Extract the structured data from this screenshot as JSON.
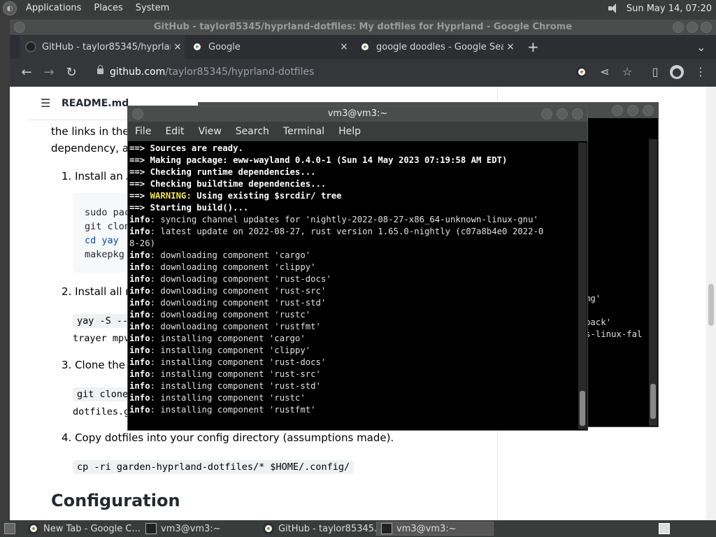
{
  "topbar": {
    "menu": [
      "Applications",
      "Places",
      "System"
    ],
    "clock": "Sun May 14, 07:20"
  },
  "chrome": {
    "window_title": "GitHub - taylor85345/hyprland-dotfiles: My dotfiles for Hyprland - Google Chrome",
    "tabs": [
      {
        "title": "GitHub - taylor85345/hyprland",
        "close": "×"
      },
      {
        "title": "Google",
        "close": "×"
      },
      {
        "title": "google doodles - Google Sear",
        "close": "×"
      }
    ],
    "new_tab": "+",
    "tab_menu": "⌄",
    "url_domain": "github.com",
    "url_path": "/taylor85345/hyprland-dotfiles",
    "icons": {
      "back": "←",
      "forward": "→",
      "reload": "↻",
      "share": "⋖",
      "star": "☆",
      "sidebar": "▯",
      "menu": "⋮"
    }
  },
  "readme": {
    "filename": "README.md",
    "intro_line1": "the links in the l",
    "intro_line2": "dependency, an",
    "step1": "1. Install an A",
    "code1": [
      "sudo pac",
      "git clon",
      "cd yay",
      "makepkg"
    ],
    "step2": "2. Install all re",
    "code2a": "yay -S --",
    "code2b": "trayer mpv",
    "step3": "3. Clone the r",
    "code3a": "git clone",
    "code3b": "dotfiles.g",
    "step4": "4. Copy dotfiles into your config directory (assumptions made).",
    "code4": "cp -ri garden-hyprland-dotfiles/* $HOME/.config/",
    "heading": "Configuration"
  },
  "terminal_back": {
    "visible_fragments": [
      "mg'",
      "pack'",
      "s-linux-fal"
    ]
  },
  "terminal": {
    "title": "vm3@vm3:~",
    "menu": [
      "File",
      "Edit",
      "View",
      "Search",
      "Terminal",
      "Help"
    ],
    "lines": [
      {
        "p": "==>",
        "k": "b",
        "t": " Sources are ready."
      },
      {
        "p": "==>",
        "k": "b",
        "t": " Making package: eww-wayland 0.4.0-1 (Sun 14 May 2023 07:19:58 AM EDT)"
      },
      {
        "p": "==>",
        "k": "b",
        "t": " Checking runtime dependencies..."
      },
      {
        "p": "==>",
        "k": "b",
        "t": " Checking buildtime dependencies..."
      },
      {
        "p": "==>",
        "k": "y",
        "w": " WARNING:",
        "t": " Using existing $srcdir/ tree"
      },
      {
        "p": "==>",
        "k": "b",
        "t": " Starting build()..."
      },
      {
        "p": "info",
        "k": "i",
        "t": ": syncing channel updates for 'nightly-2022-08-27-x86_64-unknown-linux-gnu'"
      },
      {
        "p": "info",
        "k": "i",
        "t": ": latest update on 2022-08-27, rust version 1.65.0-nightly (c07a8b4e0 2022-0"
      },
      {
        "p": "",
        "k": "n",
        "t": "8-26)"
      },
      {
        "p": "info",
        "k": "i",
        "t": ": downloading component 'cargo'"
      },
      {
        "p": "info",
        "k": "i",
        "t": ": downloading component 'clippy'"
      },
      {
        "p": "info",
        "k": "i",
        "t": ": downloading component 'rust-docs'"
      },
      {
        "p": "info",
        "k": "i",
        "t": ": downloading component 'rust-src'"
      },
      {
        "p": "info",
        "k": "i",
        "t": ": downloading component 'rust-std'"
      },
      {
        "p": "info",
        "k": "i",
        "t": ": downloading component 'rustc'"
      },
      {
        "p": "info",
        "k": "i",
        "t": ": downloading component 'rustfmt'"
      },
      {
        "p": "info",
        "k": "i",
        "t": ": installing component 'cargo'"
      },
      {
        "p": "info",
        "k": "i",
        "t": ": installing component 'clippy'"
      },
      {
        "p": "info",
        "k": "i",
        "t": ": installing component 'rust-docs'"
      },
      {
        "p": "info",
        "k": "i",
        "t": ": installing component 'rust-src'"
      },
      {
        "p": "info",
        "k": "i",
        "t": ": installing component 'rust-std'"
      },
      {
        "p": "info",
        "k": "i",
        "t": ": installing component 'rustc'"
      },
      {
        "p": "info",
        "k": "i",
        "t": ": installing component 'rustfmt'"
      }
    ]
  },
  "taskbar": {
    "items": [
      "New Tab - Google C...",
      "vm3@vm3:~",
      "GitHub - taylor85345...",
      "vm3@vm3:~"
    ]
  }
}
